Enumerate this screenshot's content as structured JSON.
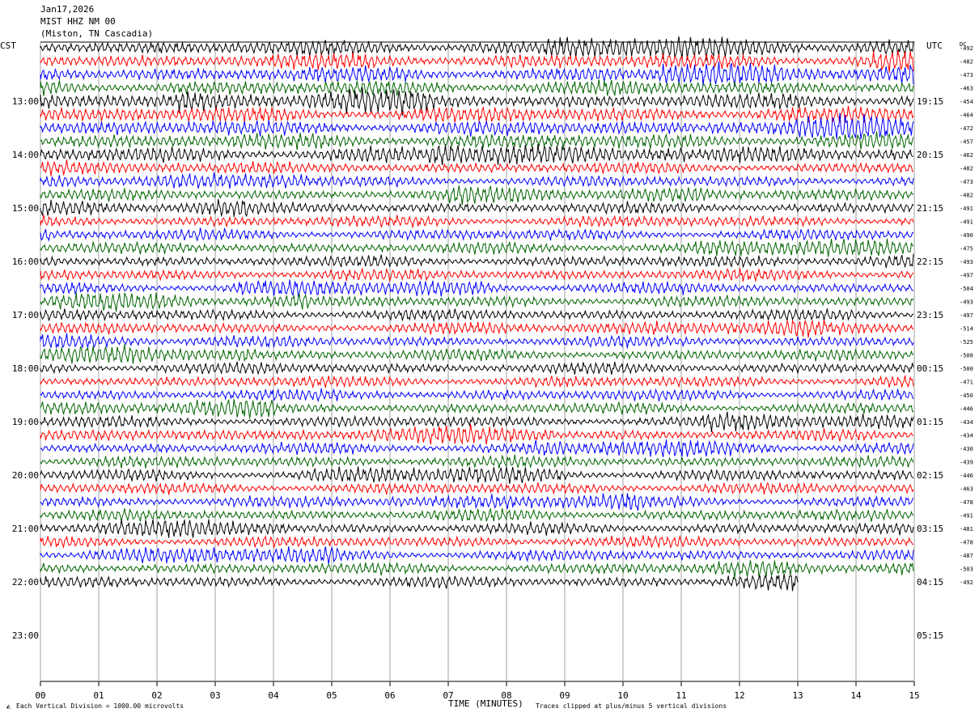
{
  "header": {
    "date": "Jan17,2026",
    "station": "MIST HHZ NM 00",
    "location": "(Miston, TN Cascadia)"
  },
  "labels": {
    "left_tz": "CST",
    "right_tz": "UTC",
    "dc": "DC"
  },
  "footer": {
    "division": "Each Vertical Division = 1000.00 microvolts",
    "xlabel": "TIME (MINUTES)",
    "clip_note": "Traces clipped at plus/minus 5 vertical divisions"
  },
  "colors": {
    "trace_cycle": [
      "#000000",
      "#ff0000",
      "#0000ff",
      "#006400"
    ],
    "grid": "#a0a0a0",
    "background": "#ffffff"
  },
  "chart_data": {
    "type": "line",
    "subtype": "helicorder",
    "x_ticks": [
      "00",
      "01",
      "02",
      "03",
      "04",
      "05",
      "06",
      "07",
      "08",
      "09",
      "10",
      "11",
      "12",
      "13",
      "14",
      "15"
    ],
    "x_range_minutes": [
      0,
      15
    ],
    "left_hour_labels": [
      "13:00",
      "14:00",
      "15:00",
      "16:00",
      "17:00",
      "18:00",
      "19:00",
      "20:00",
      "21:00",
      "22:00",
      "23:00"
    ],
    "right_hour_labels": [
      "19:15",
      "20:15",
      "21:15",
      "22:15",
      "23:15",
      "00:15",
      "01:15",
      "02:15",
      "03:15",
      "04:15",
      "05:15"
    ],
    "dc_offsets": [
      "-492",
      "-482",
      "-473",
      "-463",
      "-454",
      "-464",
      "-472",
      "-457",
      "-462",
      "-482",
      "-473",
      "-482",
      "-491",
      "-491",
      "-490",
      "-475",
      "-493",
      "-497",
      "-504",
      "-493",
      "-497",
      "-514",
      "-525",
      "-508",
      "-500",
      "-471",
      "-450",
      "-446",
      "-434",
      "-434",
      "-430",
      "-439",
      "-446",
      "-463",
      "-478",
      "-491",
      "-481",
      "-478",
      "-487",
      "-503",
      "-492"
    ],
    "last_trace_end_minute": 13.0,
    "grid": true
  }
}
